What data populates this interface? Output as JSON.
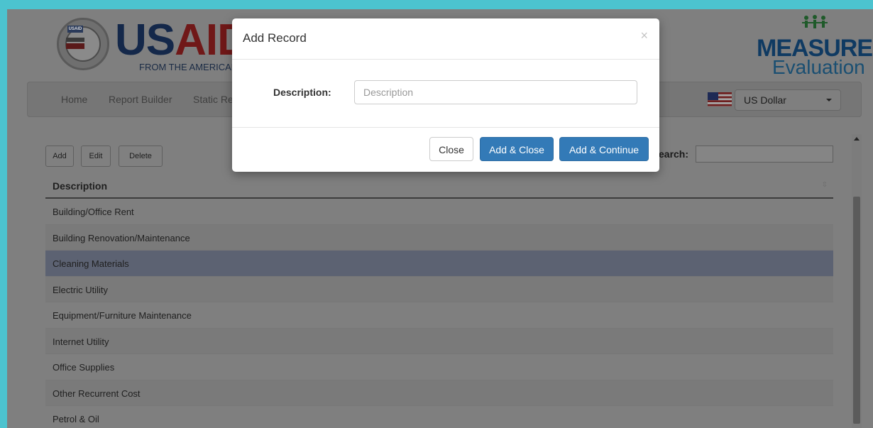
{
  "header": {
    "usaid_us": "US",
    "usaid_aid": "AID",
    "usaid_tag": "USAID",
    "usaid_tagline": "FROM THE AMERICAN PEOPLE",
    "measure_line1": "MEASURE",
    "measure_line2": "Evaluation"
  },
  "nav": {
    "items": [
      "Home",
      "Report Builder",
      "Static Re"
    ],
    "currency": "US Dollar"
  },
  "toolbar": {
    "add": "Add",
    "edit": "Edit",
    "delete": "Delete",
    "search_label": "earch:"
  },
  "table": {
    "header": "Description",
    "rows": [
      "Building/Office Rent",
      "Building Renovation/Maintenance",
      "Cleaning Materials",
      "Electric Utility",
      "Equipment/Furniture Maintenance",
      "Internet Utility",
      "Office Supplies",
      "Other Recurrent Cost",
      "Petrol & Oil"
    ],
    "selected_row": "Cleaning Materials"
  },
  "modal": {
    "title": "Add Record",
    "close_glyph": "×",
    "field_label": "Description:",
    "field_placeholder": "Description",
    "field_value": "",
    "btn_close": "Close",
    "btn_add_close": "Add & Close",
    "btn_add_continue": "Add & Continue"
  },
  "colors": {
    "primary": "#337ab7",
    "overlay": "#7f7f7f",
    "selected_row": "#5c6272",
    "outer_border": "#4cc3cf"
  }
}
